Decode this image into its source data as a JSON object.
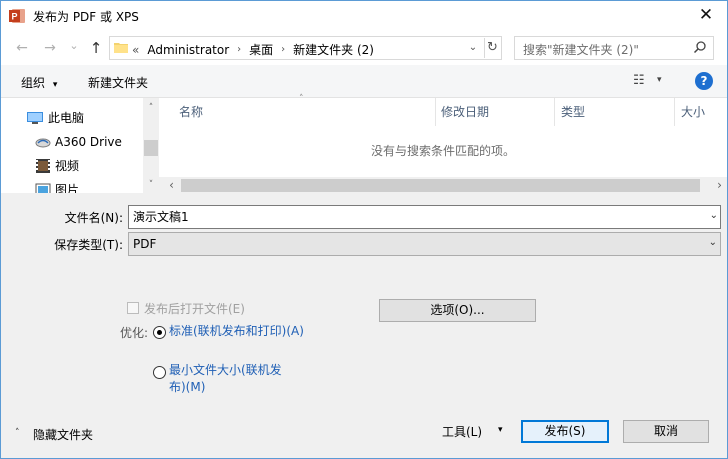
{
  "window": {
    "title": "发布为 PDF 或 XPS",
    "close_glyph": "✕"
  },
  "nav": {
    "back_glyph": "←",
    "forward_glyph": "→",
    "recent_glyph": "⌄",
    "up_glyph": "↑",
    "address": {
      "overflow": "«",
      "crumbs": [
        "Administrator",
        "桌面",
        "新建文件夹 (2)"
      ],
      "sep": "›",
      "dropdown_glyph": "⌄",
      "refresh_glyph": "↻"
    },
    "search_placeholder": "搜索\"新建文件夹 (2)\""
  },
  "toolbar": {
    "organize_label": "组织",
    "organize_arrow": "▾",
    "new_folder_label": "新建文件夹",
    "view_glyph": "☷",
    "view_arrow": "▾",
    "help_glyph": "?"
  },
  "nav_pane": {
    "items": [
      {
        "label": "此电脑",
        "icon": "computer-icon"
      },
      {
        "label": "A360 Drive",
        "icon": "cloud-drive-icon"
      },
      {
        "label": "视频",
        "icon": "video-folder-icon"
      },
      {
        "label": "图片",
        "icon": "pictures-folder-icon"
      }
    ],
    "scroll_up_glyph": "˄",
    "scroll_down_glyph": "˅"
  },
  "file_list": {
    "columns": [
      "名称",
      "修改日期",
      "类型",
      "大小"
    ],
    "sort_glyph": "˄",
    "empty_message": "没有与搜索条件匹配的项。",
    "hscroll_left": "‹",
    "hscroll_right": "›"
  },
  "form": {
    "filename_label": "文件名(N):",
    "filename_value": "演示文稿1",
    "filetype_label": "保存类型(T):",
    "filetype_value": "PDF",
    "dropdown_glyph": "⌄"
  },
  "options": {
    "open_after_publish_label": "发布后打开文件(E)",
    "options_button": "选项(O)...",
    "optimize_label": "优化:",
    "standard_label": "标准(联机发布和打印)(A)",
    "minimum_label": "最小文件大小(联机发布)(M)"
  },
  "footer": {
    "hide_folders_glyph": "˄",
    "hide_folders_label": "隐藏文件夹",
    "tools_label": "工具(L)",
    "tools_arrow": "▾",
    "publish_button": "发布(S)",
    "cancel_button": "取消"
  },
  "colors": {
    "window_border": "#5b9bd5",
    "accent": "#0078d7",
    "help_icon": "#1e6fd0",
    "radio_label": "#1f5fb5",
    "app_icon": "#c43e1c"
  }
}
